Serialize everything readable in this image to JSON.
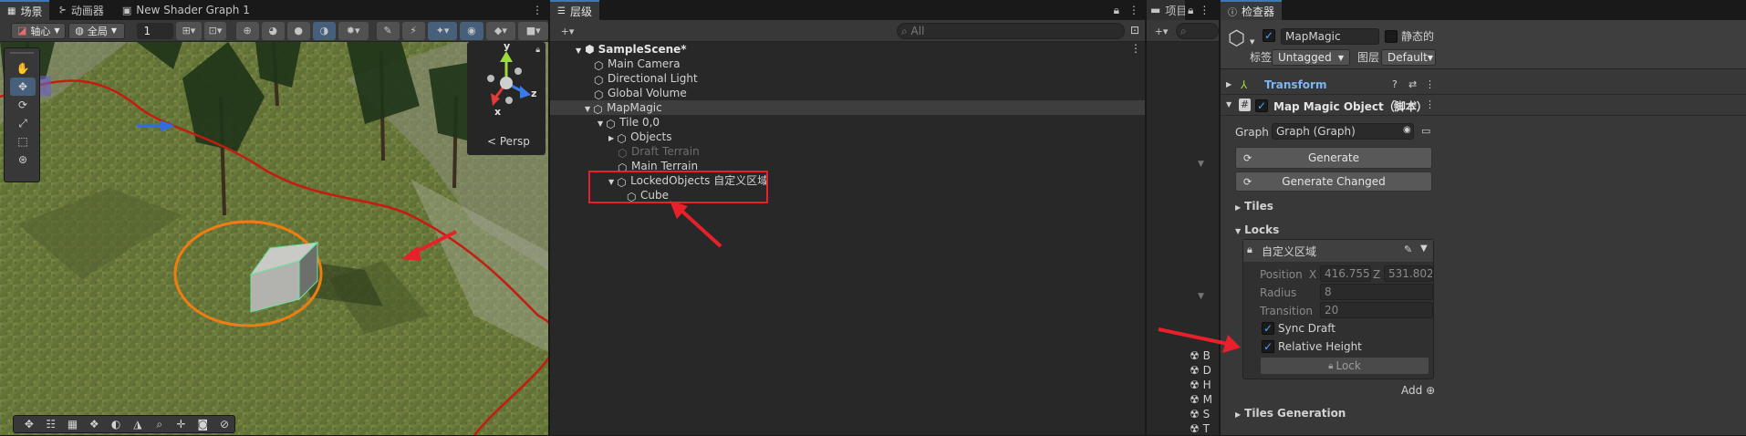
{
  "scene_tabs": {
    "scene": "场景",
    "animator": "动画器",
    "shader_graph": "New Shader Graph 1"
  },
  "scene_toolbar": {
    "pivot": "轴心",
    "global": "全局",
    "grid_value": "1"
  },
  "gizmo": {
    "y": "y",
    "z": "z",
    "x": "x",
    "persp": "Persp"
  },
  "hierarchy": {
    "tab": "层级",
    "search_placeholder": "All",
    "scene_name": "SampleScene*",
    "items": [
      {
        "label": "Main Camera"
      },
      {
        "label": "Directional Light"
      },
      {
        "label": "Global Volume"
      },
      {
        "label": "MapMagic"
      },
      {
        "label": "Tile 0,0"
      },
      {
        "label": "Objects"
      },
      {
        "label": "Draft Terrain"
      },
      {
        "label": "Main Terrain"
      },
      {
        "label": "LockedObjects 自定义区域"
      },
      {
        "label": "Cube"
      }
    ]
  },
  "project": {
    "tab": "项目",
    "items": [
      "B",
      "D",
      "H",
      "M",
      "S",
      "T"
    ]
  },
  "inspector": {
    "tab": "检查器",
    "object_name": "MapMagic",
    "static_label": "静态的",
    "tag_label": "标签",
    "tag_value": "Untagged",
    "layer_label": "图层",
    "layer_value": "Default",
    "transform": "Transform",
    "component": "Map Magic Object（脚本）",
    "graph_label": "Graph",
    "graph_value": "Graph (Graph)",
    "generate": "Generate",
    "generate_changed": "Generate Changed",
    "tiles": "Tiles",
    "locks": "Locks",
    "lock_name": "自定义区域",
    "position_label": "Position",
    "x_label": "X",
    "x_value": "416.755",
    "z_label": "Z",
    "z_value": "531.8022",
    "radius_label": "Radius",
    "radius_value": "8",
    "transition_label": "Transition",
    "transition_value": "20",
    "sync_draft": "Sync Draft",
    "relative_height": "Relative Height",
    "lock_button": "Lock",
    "add_label": "Add",
    "tiles_generation": "Tiles Generation"
  },
  "colors": {
    "accent": "#3a79bb",
    "annotation_red": "#e8202a",
    "annotation_orange": "#f07d10",
    "panel": "#383838",
    "header": "#3e3e3e"
  }
}
